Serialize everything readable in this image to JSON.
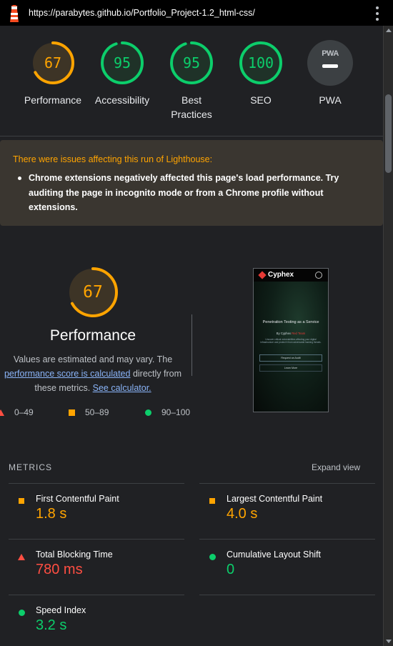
{
  "browser": {
    "url": "https://parabytes.github.io/Portfolio_Project-1.2_html-css/",
    "menu_icon": "kebab-menu-icon"
  },
  "colors": {
    "pass": "#0cce6b",
    "average": "#ffa400",
    "fail": "#ff4e42",
    "link": "#8ab4f8"
  },
  "scores": [
    {
      "label": "Performance",
      "value": "67",
      "rating": "average"
    },
    {
      "label": "Accessibility",
      "value": "95",
      "rating": "pass"
    },
    {
      "label": "Best Practices",
      "value": "95",
      "rating": "pass"
    },
    {
      "label": "SEO",
      "value": "100",
      "rating": "pass"
    },
    {
      "label": "PWA",
      "value": "",
      "badge_text": "PWA",
      "rating": "na"
    }
  ],
  "warning": {
    "heading": "There were issues affecting this run of Lighthouse:",
    "items": [
      "Chrome extensions negatively affected this page's load performance. Try auditing the page in incognito mode or from a Chrome profile without extensions."
    ]
  },
  "performance": {
    "score": "67",
    "title": "Performance",
    "desc_prefix": "Values are estimated and may vary. The ",
    "desc_link1": "performance score is calculated",
    "desc_middle": " directly from these metrics. ",
    "desc_link2": "See calculator."
  },
  "legend": [
    {
      "range": "0–49",
      "shape": "triangle"
    },
    {
      "range": "50–89",
      "shape": "square"
    },
    {
      "range": "90–100",
      "shape": "circle"
    }
  ],
  "thumbnail": {
    "brand": "Cyphex",
    "headline": "Penetration Testing as a Service",
    "byline_prefix": "By Cyphex ",
    "byline_red": "Red Team",
    "paragraph": "Uncover critical vulnerabilities affecting your digital infrastructure and protect it from adversarial hacking threats.",
    "button1": "Request an Audit",
    "button2": "Learn More"
  },
  "metrics": {
    "title": "METRICS",
    "expand_label": "Expand view",
    "items": [
      {
        "name": "First Contentful Paint",
        "value": "1.8 s",
        "rating": "average"
      },
      {
        "name": "Largest Contentful Paint",
        "value": "4.0 s",
        "rating": "average"
      },
      {
        "name": "Total Blocking Time",
        "value": "780 ms",
        "rating": "fail"
      },
      {
        "name": "Cumulative Layout Shift",
        "value": "0",
        "rating": "pass"
      },
      {
        "name": "Speed Index",
        "value": "3.2 s",
        "rating": "pass"
      }
    ]
  }
}
